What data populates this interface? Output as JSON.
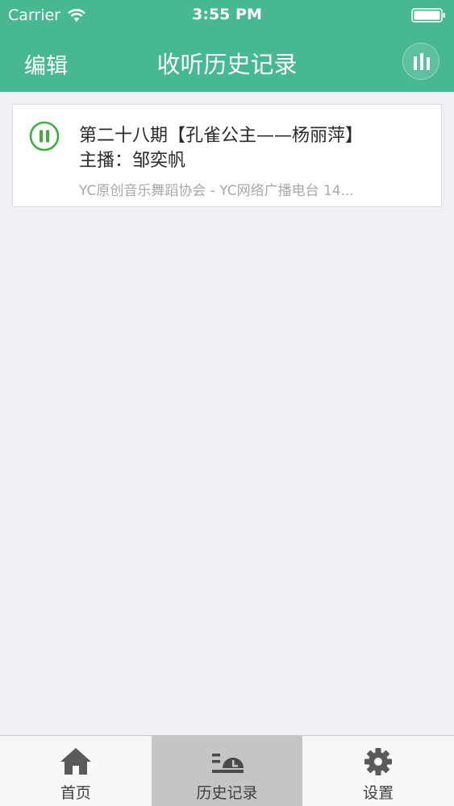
{
  "status_bar": {
    "carrier": "Carrier",
    "time": "3:55 PM"
  },
  "nav": {
    "edit_label": "编辑",
    "title": "收听历史记录",
    "playing_icon": "equalizer-icon"
  },
  "history": [
    {
      "title": "第二十八期【孔雀公主——杨丽萍】",
      "host": "主播：邹奕帆",
      "meta": "YC原创音乐舞蹈协会 - YC网络广播电台  14...",
      "state_icon": "pause-icon"
    }
  ],
  "tab_bar": {
    "tabs": [
      {
        "label": "首页",
        "icon": "home-icon",
        "active": false
      },
      {
        "label": "历史记录",
        "icon": "history-icon",
        "active": true
      },
      {
        "label": "设置",
        "icon": "gear-icon",
        "active": false
      }
    ]
  },
  "colors": {
    "accent": "#47b893",
    "play_green": "#3fae3c",
    "active_tab": "#c5c5c5",
    "background": "#efeff4"
  }
}
